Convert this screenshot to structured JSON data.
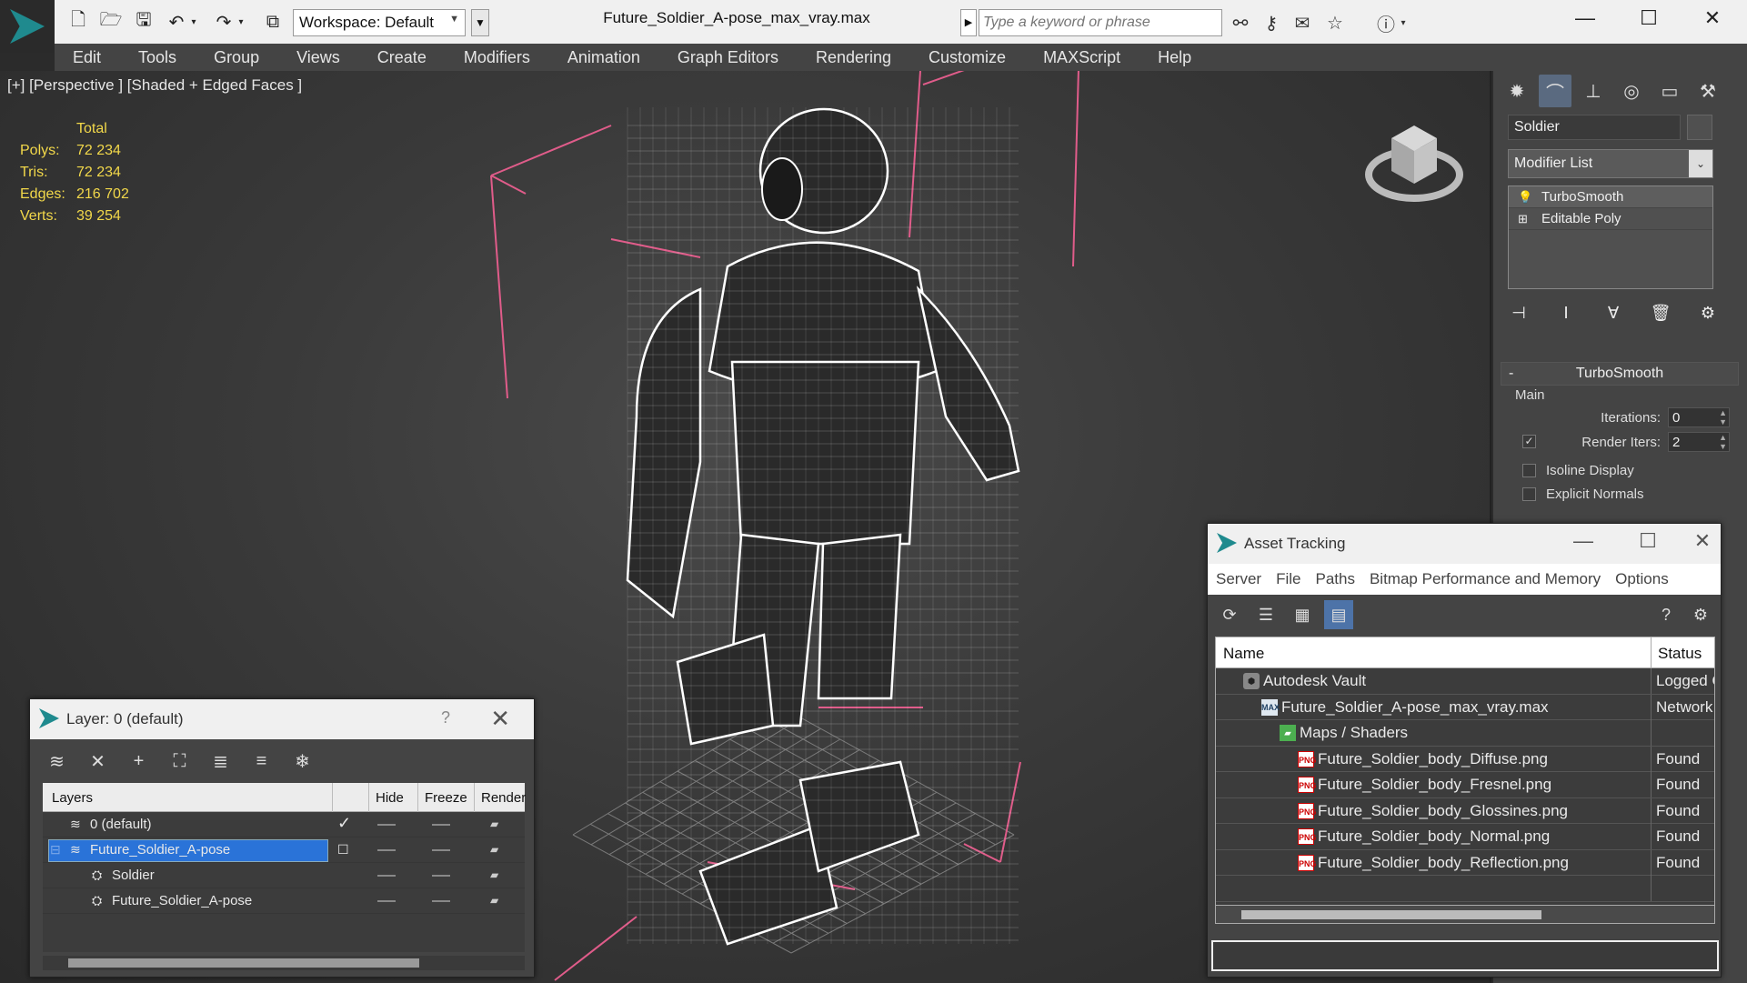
{
  "titlebar": {
    "workspace_label": "Workspace: Default",
    "document_title": "Future_Soldier_A-pose_max_vray.max",
    "search_placeholder": "Type a keyword or phrase"
  },
  "menu": [
    "Edit",
    "Tools",
    "Group",
    "Views",
    "Create",
    "Modifiers",
    "Animation",
    "Graph Editors",
    "Rendering",
    "Customize",
    "MAXScript",
    "Help"
  ],
  "viewport": {
    "label": "[+] [Perspective ] [Shaded + Edged Faces ]",
    "stats": {
      "header": "Total",
      "rows": [
        {
          "k": "Polys:",
          "v": "72 234"
        },
        {
          "k": "Tris:",
          "v": "72 234"
        },
        {
          "k": "Edges:",
          "v": "216 702"
        },
        {
          "k": "Verts:",
          "v": "39 254"
        }
      ]
    },
    "colors": {
      "bbox": "#e05c8a",
      "wire": "#ffffff",
      "grid": "#7a7a7a"
    }
  },
  "command_panel": {
    "object_name": "Soldier",
    "modifier_list": "Modifier List",
    "stack": [
      {
        "label": "TurboSmooth",
        "icon": "lightbulb-icon"
      },
      {
        "label": "Editable Poly",
        "icon": "plus-expand-icon"
      }
    ],
    "rollout": {
      "title": "TurboSmooth",
      "group": "Main",
      "iterations_label": "Iterations:",
      "iterations_value": "0",
      "render_iters_label": "Render Iters:",
      "render_iters_value": "2",
      "render_iters_checked": true,
      "isoline_label": "Isoline Display",
      "explicit_label": "Explicit Normals"
    }
  },
  "layer_dialog": {
    "title": "Layer: 0 (default)",
    "help": "?",
    "columns": [
      "Layers",
      "Hide",
      "Freeze",
      "Render"
    ],
    "rows": [
      {
        "name": "0 (default)",
        "indent": 0,
        "selected": false
      },
      {
        "name": "Future_Soldier_A-pose",
        "indent": 0,
        "selected": true
      },
      {
        "name": "Soldier",
        "indent": 1,
        "selected": false
      },
      {
        "name": "Future_Soldier_A-pose",
        "indent": 1,
        "selected": false
      }
    ]
  },
  "asset_dialog": {
    "title": "Asset Tracking",
    "menu": [
      "Server",
      "File",
      "Paths",
      "Bitmap Performance and Memory",
      "Options"
    ],
    "columns": [
      "Name",
      "Status"
    ],
    "rows": [
      {
        "name": "Autodesk Vault",
        "status": "Logged Out",
        "indent": 0,
        "icon": "vault"
      },
      {
        "name": "Future_Soldier_A-pose_max_vray.max",
        "status": "Network",
        "indent": 1,
        "icon": "max"
      },
      {
        "name": "Maps / Shaders",
        "status": "",
        "indent": 2,
        "icon": "maps"
      },
      {
        "name": "Future_Soldier_body_Diffuse.png",
        "status": "Found",
        "indent": 3,
        "icon": "png"
      },
      {
        "name": "Future_Soldier_body_Fresnel.png",
        "status": "Found",
        "indent": 3,
        "icon": "png"
      },
      {
        "name": "Future_Soldier_body_Glossines.png",
        "status": "Found",
        "indent": 3,
        "icon": "png"
      },
      {
        "name": "Future_Soldier_body_Normal.png",
        "status": "Found",
        "indent": 3,
        "icon": "png"
      },
      {
        "name": "Future_Soldier_body_Reflection.png",
        "status": "Found",
        "indent": 3,
        "icon": "png"
      }
    ]
  }
}
